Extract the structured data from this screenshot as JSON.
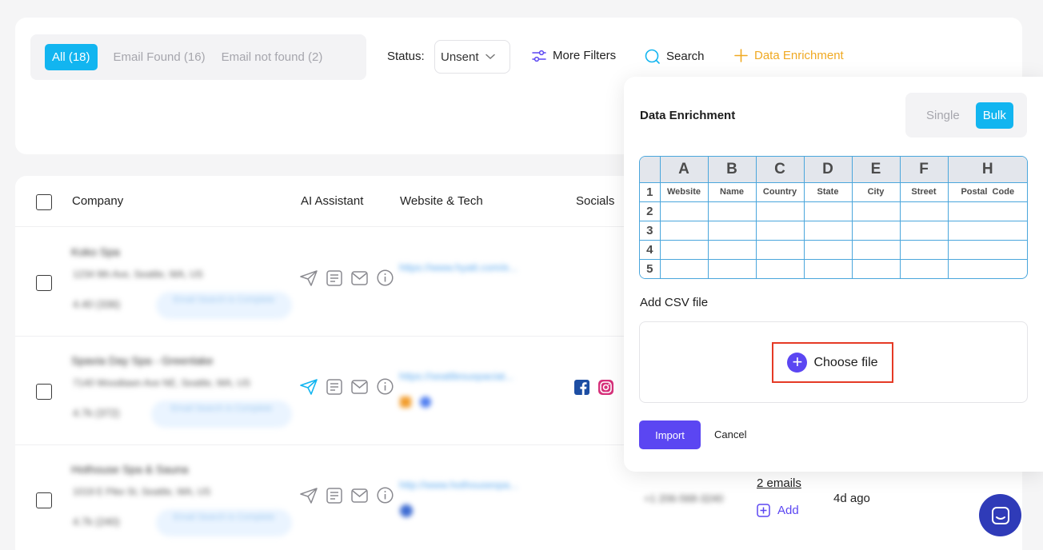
{
  "filters": {
    "tabs": [
      {
        "label": "All (18)",
        "active": true
      },
      {
        "label": "Email Found (16)",
        "active": false
      },
      {
        "label": "Email not found (2)",
        "active": false
      }
    ],
    "status_label": "Status:",
    "status_value": "Unsent",
    "more_filters": "More Filters",
    "search": "Search",
    "data_enrichment": "Data Enrichment"
  },
  "table": {
    "columns": [
      "Company",
      "AI Assistant",
      "Website & Tech",
      "Socials"
    ],
    "rows": [
      {
        "company": "Koko Spa",
        "address": "1234 9th Ave, Seattle, WA, US",
        "rating": "4.40 (336)",
        "pill": "Email Search is Complete",
        "website": "https://www.hyatt.com/e..."
      },
      {
        "company": "Spavia Day Spa - Greenlake",
        "address": "7140 Woodlawn Ave NE, Seattle, WA, US",
        "rating": "4.7k (372)",
        "pill": "Email Search is Complete",
        "website": "https://seattlesuspaciat..."
      },
      {
        "company": "Hothouse Spa & Sauna",
        "address": "1019 E Pike St, Seattle, WA, US",
        "rating": "4.7k (240)",
        "pill": "Email Search is Complete",
        "website": "http://www.hothousespa...",
        "phone": "+1 206-568-3240",
        "emails": "2 emails",
        "add": "Add",
        "ago": "4d ago"
      }
    ]
  },
  "panel": {
    "title": "Data Enrichment",
    "modes": [
      {
        "label": "Single",
        "active": false
      },
      {
        "label": "Bulk",
        "active": true
      }
    ],
    "sheet": {
      "col_letters": [
        "A",
        "B",
        "C",
        "D",
        "E",
        "F",
        "H"
      ],
      "headers": [
        "Website",
        "Name",
        "Country",
        "State",
        "City",
        "Street",
        "Postal  Code"
      ],
      "row_numbers": [
        "1",
        "2",
        "3",
        "4",
        "5"
      ]
    },
    "csv_label": "Add CSV file",
    "choose_file": "Choose file",
    "import": "Import",
    "cancel": "Cancel"
  },
  "colors": {
    "accent_blue": "#12b5f0",
    "primary_purple": "#5b46f2",
    "enrich_orange": "#f0a922",
    "highlight_red": "#e53a25"
  }
}
